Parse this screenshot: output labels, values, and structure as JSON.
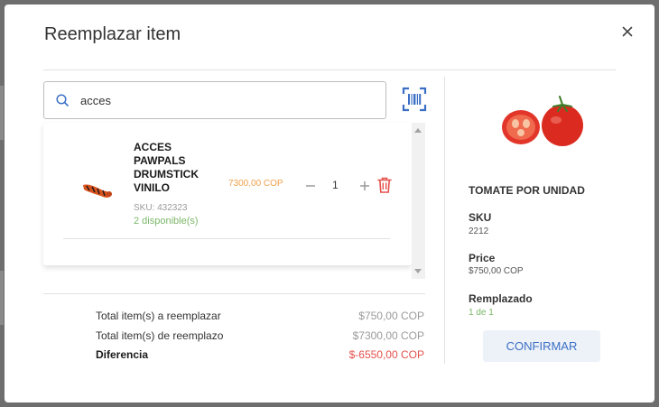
{
  "modal": {
    "title": "Reemplazar item"
  },
  "search": {
    "value": "acces",
    "icon": "search-icon",
    "barcode_icon": "barcode-scan-icon"
  },
  "results": [
    {
      "name": "ACCES PAWPALS DRUMSTICK VINILO",
      "sku": "SKU: 432323",
      "stock": "2 disponible(s)",
      "price": "7300,00 COP",
      "quantity": "1"
    }
  ],
  "totals": [
    {
      "label": "Total item(s) a reemplazar",
      "value": "$750,00 COP"
    },
    {
      "label": "Total item(s) de reemplazo",
      "value": "$7300,00 COP"
    },
    {
      "label": "Diferencia",
      "value": "$-6550,00 COP"
    }
  ],
  "original": {
    "name": "TOMATE POR UNIDAD",
    "sku_label": "SKU",
    "sku": "2212",
    "price_label": "Price",
    "price": "$750,00 COP",
    "replaced_label": "Remplazado",
    "replaced": "1 de 1"
  },
  "actions": {
    "confirm_label": "CONFIRMAR"
  },
  "colors": {
    "accent": "#3b6fc5",
    "price": "#f0a04b",
    "available": "#7cb76a",
    "negative": "#e4514c",
    "delete": "#e4514c"
  }
}
